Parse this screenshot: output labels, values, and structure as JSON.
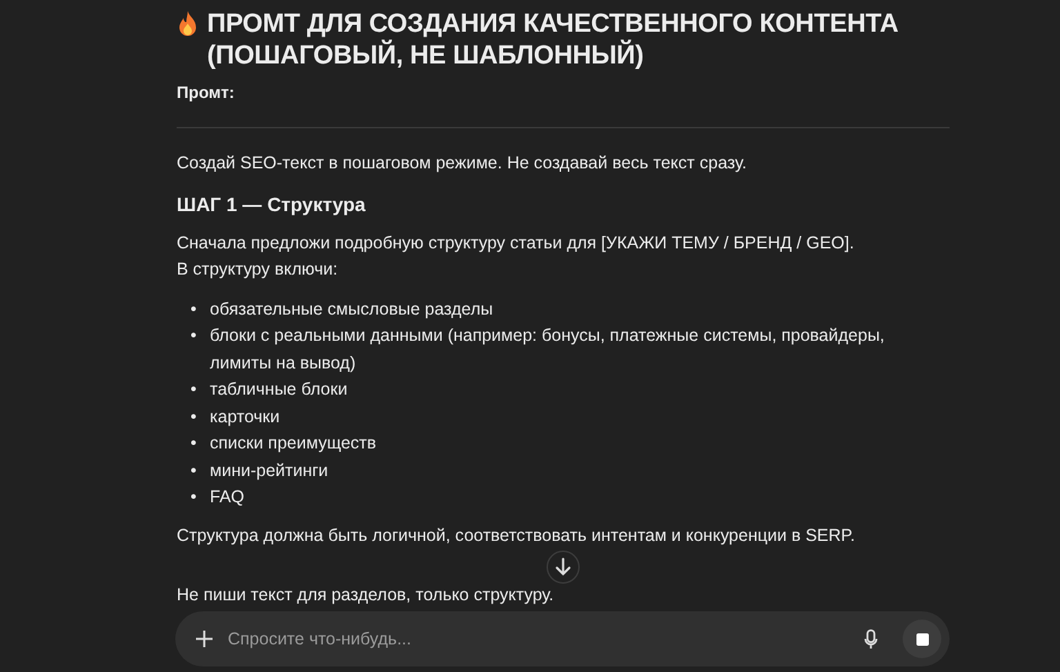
{
  "title": "ПРОМТ ДЛЯ СОЗДАНИЯ КАЧЕСТВЕННОГО КОНТЕНТА (ПОШАГОВЫЙ, НЕ ШАБЛОННЫЙ)",
  "prompt_label": "Промт:",
  "blocks": [
    {
      "kind": "paragraph",
      "text": "Создай SEO-текст в пошаговом режиме. Не создавай весь текст сразу."
    },
    {
      "kind": "heading",
      "text": "ШАГ 1 — Структура"
    },
    {
      "kind": "lines",
      "lines": [
        "Сначала предложи подробную структуру статьи для [УКАЖИ ТЕМУ / БРЕНД / GEO].",
        "В структуру включи:"
      ]
    },
    {
      "kind": "list",
      "bullet": "•",
      "items": [
        "обязательные смысловые разделы",
        "блоки с реальными данными (например: бонусы, платежные системы, провайдеры, лимиты на вывод)",
        "табличные блоки",
        "карточки",
        "списки преимуществ",
        "мини-рейтинги",
        "FAQ"
      ]
    },
    {
      "kind": "paragraph",
      "text": "Структура должна быть логичной, соответствовать интентам и конкуренции в SERP."
    },
    {
      "kind": "paragraph",
      "text": "Не пиши текст для разделов, только структуру."
    }
  ],
  "composer": {
    "placeholder": "Спросите что-нибудь..."
  }
}
